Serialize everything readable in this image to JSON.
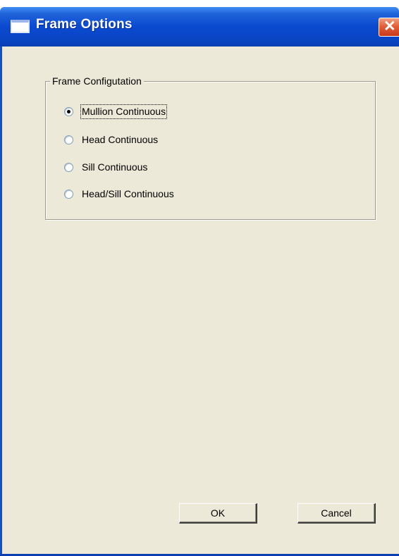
{
  "window": {
    "title": "Frame Options",
    "close_glyph": "✕"
  },
  "frame_configuration": {
    "legend": "Frame Configutation",
    "options": [
      {
        "label": "Mullion Continuous",
        "checked": true
      },
      {
        "label": "Head Continuous",
        "checked": false
      },
      {
        "label": "Sill Continuous",
        "checked": false
      },
      {
        "label": "Head/Sill Continuous",
        "checked": false
      }
    ]
  },
  "buttons": {
    "ok_label": "OK",
    "cancel_label": "Cancel"
  },
  "colors": {
    "title_bar": "#0a49d0",
    "dialog_background": "#ece9d8",
    "close_button": "#e0603a"
  },
  "icons": {
    "title": "window-app-icon",
    "close": "close-icon"
  }
}
